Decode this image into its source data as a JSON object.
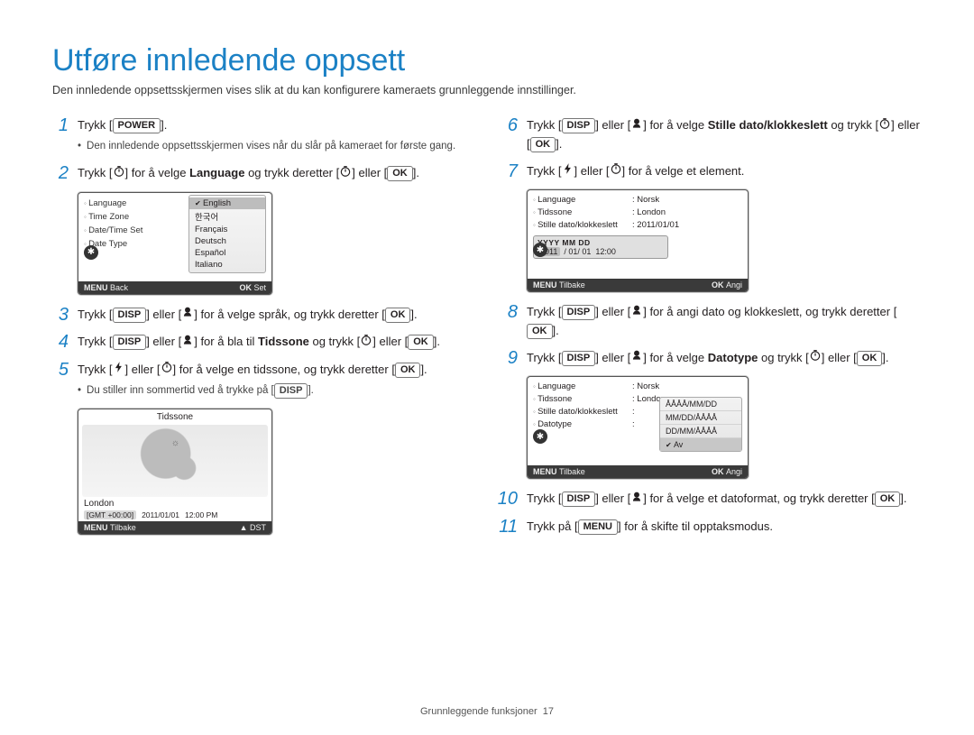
{
  "page_title": "Utføre innledende oppsett",
  "intro": "Den innledende oppsettsskjermen vises slik at du kan konfigurere kameraets grunnleggende innstillinger.",
  "steps": {
    "1": {
      "text_a": "Trykk [",
      "tag": "POWER",
      "text_b": "].",
      "bullet": "Den innledende oppsettsskjermen vises når du slår på kameraet for første gang."
    },
    "2": {
      "pre": "Trykk [",
      "mid": "] for å velge ",
      "bold": "Language",
      "post": " og trykk deretter [",
      "or": "] eller [",
      "end": "]."
    },
    "3": {
      "pre": "Trykk [",
      "or": "] eller [",
      "mid": "] for å velge språk, og trykk deretter [",
      "end": "]."
    },
    "4": {
      "pre": "Trykk [",
      "or": "] eller [",
      "mid": "] for å bla til ",
      "bold": "Tidssone",
      "post": " og trykk [",
      "or2": "] eller [",
      "end": "]."
    },
    "5": {
      "pre": "Trykk [",
      "or": "] eller [",
      "mid": "] for å velge en tidssone, og trykk deretter [",
      "end": "].",
      "bullet": "Du stiller inn sommertid ved å trykke på [",
      "bullet_end": "]."
    },
    "6": {
      "pre": "Trykk [",
      "or": "] eller [",
      "mid": "] for å velge ",
      "bold": "Stille dato/klokkeslett",
      "post": " og trykk [",
      "or2": "] eller [",
      "end": "]."
    },
    "7": {
      "pre": "Trykk [",
      "or": "] eller [",
      "mid": "] for å velge et element."
    },
    "8": {
      "pre": "Trykk [",
      "or": "] eller [",
      "mid": "] for å angi dato og klokkeslett, og trykk deretter [",
      "end": "]."
    },
    "9": {
      "pre": "Trykk [",
      "or": "] eller [",
      "mid": "] for å velge ",
      "bold": "Datotype",
      "post": " og trykk [",
      "or2": "] eller [",
      "end": "]."
    },
    "10": {
      "pre": "Trykk [",
      "or": "] eller [",
      "mid": "] for å velge et datoformat, og trykk deretter [",
      "end": "]."
    },
    "11": {
      "pre": "Trykk på [",
      "mid": "] for å skifte til opptaksmodus."
    }
  },
  "screens": {
    "lang": {
      "left": [
        "Language",
        "Time Zone",
        "Date/Time Set",
        "Date Type"
      ],
      "options": [
        "English",
        "한국어",
        "Français",
        "Deutsch",
        "Español",
        "Italiano"
      ],
      "selected": "English",
      "footer_l": "Back",
      "footer_r": "Set"
    },
    "map": {
      "title": "Tidssone",
      "city": "London",
      "gmt": "[GMT +00:00]",
      "date": "2011/01/01",
      "time": "12:00 PM",
      "footer_l": "Tilbake",
      "footer_r": "DST"
    },
    "date": {
      "kv": [
        {
          "k": "Language",
          "v": "Norsk"
        },
        {
          "k": "Tidssone",
          "v": "London"
        },
        {
          "k": "Stille dato/klokkeslett",
          "v": "2011/01/01"
        }
      ],
      "hdr": "YYYY MM DD",
      "row": "2011 / 01/ 01  12:00",
      "footer_l": "Tilbake",
      "footer_r": "Angi"
    },
    "type": {
      "kv": [
        {
          "k": "Language",
          "v": "Norsk"
        },
        {
          "k": "Tidssone",
          "v": "London"
        },
        {
          "k": "Stille dato/klokkeslett",
          "v": ""
        },
        {
          "k": "Datotype",
          "v": ""
        }
      ],
      "opts": [
        "ÅÅÅÅ/MM/DD",
        "MM/DD/ÅÅÅÅ",
        "DD/MM/ÅÅÅÅ",
        "Av"
      ],
      "footer_l": "Tilbake",
      "footer_r": "Angi"
    }
  },
  "footer": {
    "section": "Grunnleggende funksjoner",
    "page": "17"
  },
  "labels": {
    "menu": "MENU",
    "ok": "OK",
    "up": "▲"
  }
}
